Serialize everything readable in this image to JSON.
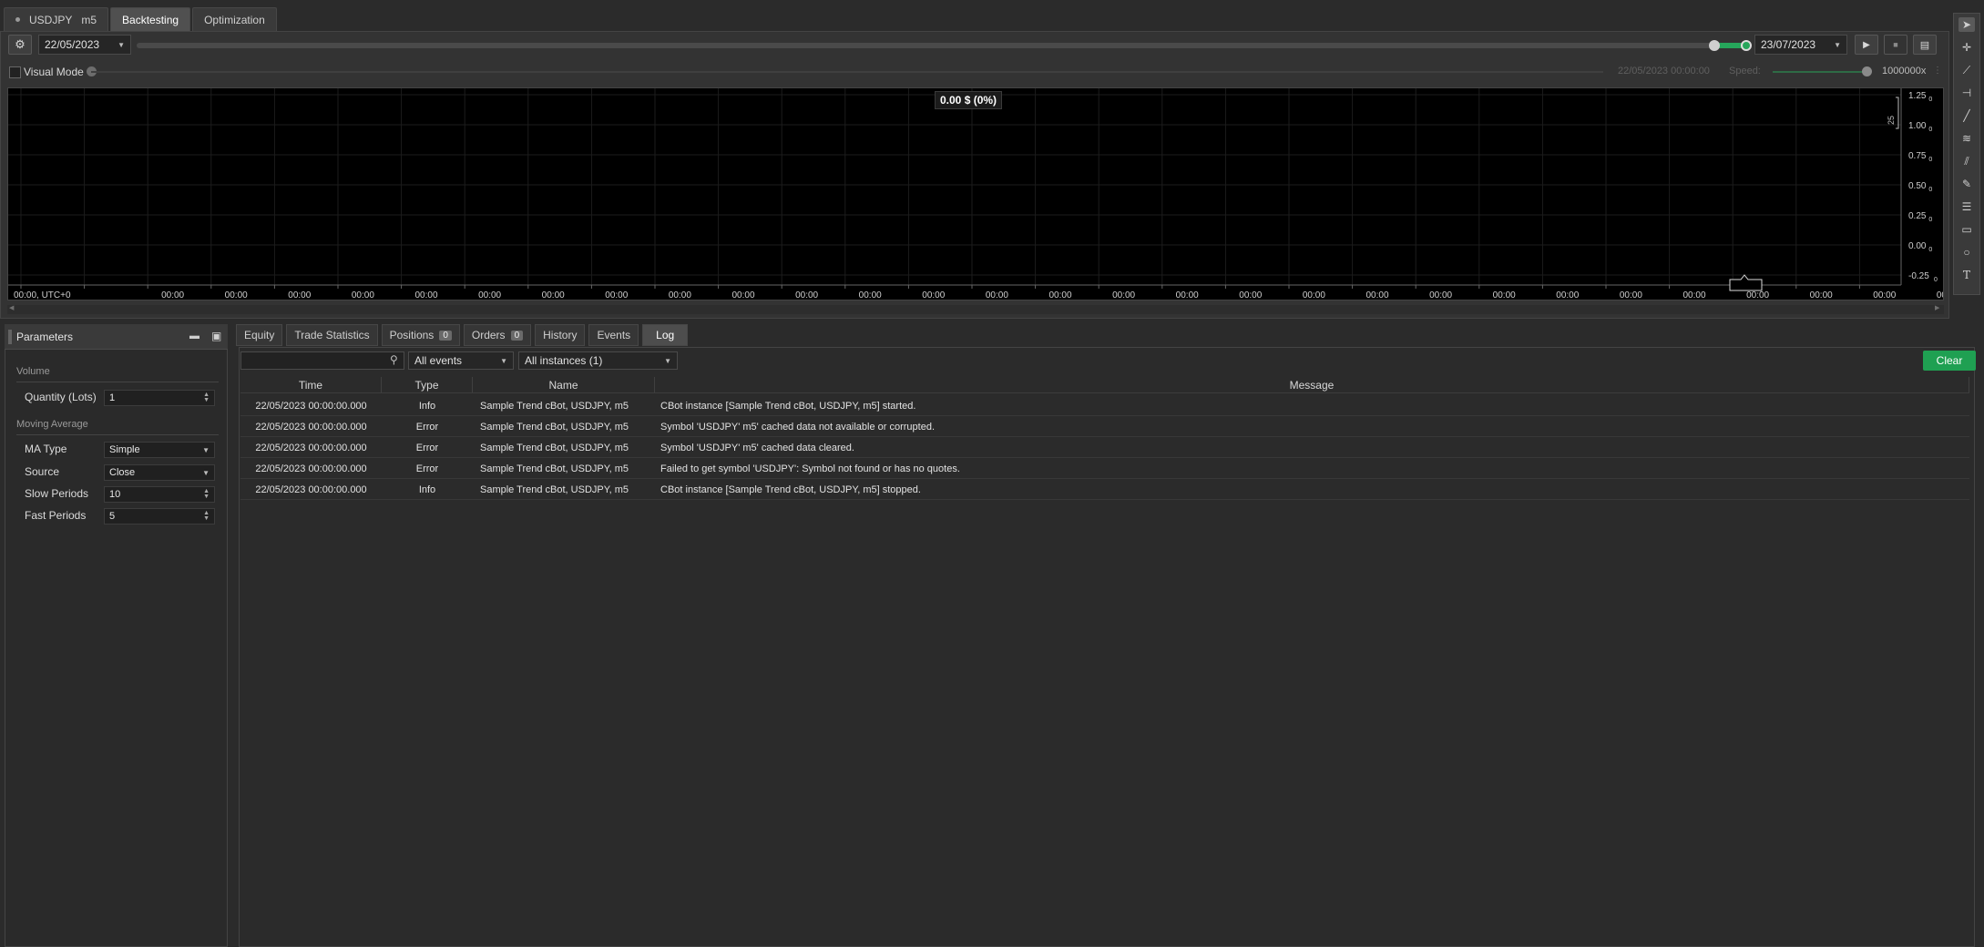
{
  "top_tabs": {
    "symbol": "USDJPY",
    "timeframe": "m5",
    "backtesting": "Backtesting",
    "optimization": "Optimization"
  },
  "toolbar": {
    "start_date": "22/05/2023",
    "end_date": "23/07/2023"
  },
  "visual_mode": {
    "label": "Visual Mode",
    "time": "22/05/2023 00:00:00",
    "speed_label": "Speed:",
    "speed_value": "1000000x"
  },
  "chart": {
    "title": "0.00 $ (0%)",
    "y_ticks": [
      "1.25",
      "1.00",
      "0.75",
      "0.50",
      "0.25",
      "0.00",
      "-0.25"
    ],
    "y_tick_suffix": "0",
    "x_first": "00:00, UTC+0",
    "x_tick": "00:00",
    "right_marker": "25"
  },
  "params": {
    "title": "Parameters",
    "sections": [
      {
        "name": "Volume",
        "fields": [
          {
            "label": "Quantity (Lots)",
            "value": "1",
            "kind": "spin"
          }
        ]
      },
      {
        "name": "Moving Average",
        "fields": [
          {
            "label": "MA Type",
            "value": "Simple",
            "kind": "select"
          },
          {
            "label": "Source",
            "value": "Close",
            "kind": "select"
          },
          {
            "label": "Slow Periods",
            "value": "10",
            "kind": "spin"
          },
          {
            "label": "Fast Periods",
            "value": "5",
            "kind": "spin"
          }
        ]
      }
    ]
  },
  "lower_tabs": {
    "equity": "Equity",
    "trade_statistics": "Trade Statistics",
    "positions": "Positions",
    "positions_count": "0",
    "orders": "Orders",
    "orders_count": "0",
    "history": "History",
    "events": "Events",
    "log": "Log"
  },
  "log": {
    "filter_events": "All events",
    "filter_instances": "All instances (1)",
    "clear": "Clear",
    "columns": {
      "time": "Time",
      "type": "Type",
      "name": "Name",
      "message": "Message"
    },
    "rows": [
      {
        "time": "22/05/2023 00:00:00.000",
        "type": "Info",
        "name": "Sample Trend cBot, USDJPY, m5",
        "message": "CBot instance [Sample Trend cBot, USDJPY, m5] started."
      },
      {
        "time": "22/05/2023 00:00:00.000",
        "type": "Error",
        "name": "Sample Trend cBot, USDJPY, m5",
        "message": "Symbol 'USDJPY' m5' cached data not available or corrupted."
      },
      {
        "time": "22/05/2023 00:00:00.000",
        "type": "Error",
        "name": "Sample Trend cBot, USDJPY, m5",
        "message": "Symbol 'USDJPY' m5' cached data cleared."
      },
      {
        "time": "22/05/2023 00:00:00.000",
        "type": "Error",
        "name": "Sample Trend cBot, USDJPY, m5",
        "message": "Failed to get symbol 'USDJPY': Symbol not found or has no quotes."
      },
      {
        "time": "22/05/2023 00:00:00.000",
        "type": "Info",
        "name": "Sample Trend cBot, USDJPY, m5",
        "message": "CBot instance [Sample Trend cBot, USDJPY, m5] stopped."
      }
    ]
  },
  "colors": {
    "accent_green": "#26a65b",
    "clear_button": "#1fa052",
    "chart_bg": "#000000",
    "panel_bg": "#2b2b2b"
  },
  "icons": [
    "gear-icon",
    "play-icon",
    "stop-icon",
    "save-icon",
    "search-icon",
    "cursor-icon",
    "crosshair-icon",
    "line-icon",
    "rectangle-icon",
    "ellipse-icon",
    "text-icon"
  ]
}
